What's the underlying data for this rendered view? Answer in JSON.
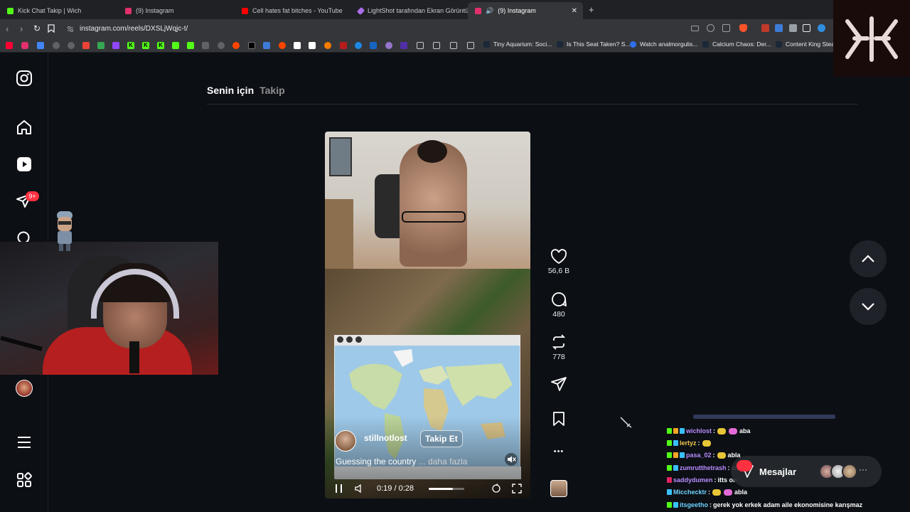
{
  "browser": {
    "tabs": [
      {
        "title": "Kick Chat Takip | Wich",
        "fav_color": "#53fc18"
      },
      {
        "title": "(9) Instagram",
        "fav_color": "#e1306c"
      },
      {
        "title": "Cell hates fat bitches - YouTube",
        "fav_color": "#ff0000"
      },
      {
        "title": "LightShot tarafından Ekran Görüntüsü",
        "fav_color": "#a96ee8"
      },
      {
        "title": "(9) Instagram",
        "fav_color": "#e1306c"
      }
    ],
    "new_tab": "+",
    "close_tab": "✕",
    "url": "instagram.com/reels/DXSLjWqjc-t/",
    "bookmarks": [
      {
        "title": "Tiny Aquarium: Soci..."
      },
      {
        "title": "Is This Seat Taken? S..."
      },
      {
        "title": "Watch analmorgulis..."
      },
      {
        "title": "Calcium Chaos: Der..."
      },
      {
        "title": "Content King Steam"
      }
    ]
  },
  "sidebar": {
    "notification_badge": "9+",
    "icons": [
      "instagram-logo-icon",
      "home-icon",
      "reels-icon",
      "messages-icon",
      "search-icon",
      "profile-avatar",
      "menu-icon",
      "more-apps-icon"
    ]
  },
  "feed_tabs": {
    "for_you": "Senin için",
    "following": "Takip"
  },
  "reel": {
    "username": "stillnotlost",
    "follow_label": "Takip Et",
    "caption": "Guessing the country",
    "more_label": "... daha fazla",
    "time": "0:19 / 0:28",
    "progress_fraction": 0.68
  },
  "actions": {
    "likes": "56,6 B",
    "comments": "480",
    "reposts": "778",
    "more": "•••"
  },
  "messages": {
    "label": "Mesajlar"
  },
  "chat": [
    {
      "user": "wichlost",
      "color": "#b98cff",
      "text": "aba"
    },
    {
      "user": "lertyz",
      "color": "#f2c94c",
      "text": ""
    },
    {
      "user": "pasa_02",
      "color": "#b98cff",
      "text": "abla"
    },
    {
      "user": "zumrutthetrash",
      "color": "#b98cff",
      "text": "abla"
    },
    {
      "user": "saddydumen",
      "color": "#b98cff",
      "text": "itts on"
    },
    {
      "user": "Micchecktr",
      "color": "#6fd3ff",
      "text": "abla"
    },
    {
      "user": "itsgeetho",
      "color": "#6fd3ff",
      "text": "gerek yok erkek adam aile ekonomisine karışmaz"
    }
  ]
}
